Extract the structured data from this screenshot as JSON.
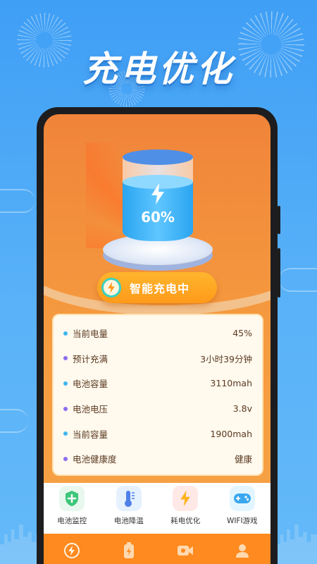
{
  "hero": {
    "title": "充电优化"
  },
  "battery": {
    "percent": "60%",
    "fill_fraction": 0.6
  },
  "status": {
    "label": "智能充电中"
  },
  "info": {
    "rows": [
      {
        "label": "当前电量",
        "value": "45%",
        "dot_color": "#3fb6f0"
      },
      {
        "label": "预计充满",
        "value": "3小时39分钟",
        "dot_color": "#8a6cf0"
      },
      {
        "label": "电池容量",
        "value": "3110mah",
        "dot_color": "#3fb6f0"
      },
      {
        "label": "电池电压",
        "value": "3.8v",
        "dot_color": "#8a6cf0"
      },
      {
        "label": "当前容量",
        "value": "1900mah",
        "dot_color": "#3fb6f0"
      },
      {
        "label": "电池健康度",
        "value": "健康",
        "dot_color": "#8a6cf0"
      }
    ]
  },
  "features": [
    {
      "label": "电池监控",
      "icon": "shield-plus-icon",
      "color": "#e8f8ef"
    },
    {
      "label": "电池降温",
      "icon": "thermometer-icon",
      "color": "#e6f1ff"
    },
    {
      "label": "耗电优化",
      "icon": "bolt-icon",
      "color": "#ffe9e6"
    },
    {
      "label": "WIFI游戏",
      "icon": "gamepad-icon",
      "color": "#e3f6ff"
    }
  ],
  "tabs": [
    {
      "icon": "charge-bolt-icon",
      "active": true
    },
    {
      "icon": "battery-icon",
      "active": false
    },
    {
      "icon": "video-icon",
      "active": false
    },
    {
      "icon": "user-icon",
      "active": false
    }
  ],
  "colors": {
    "background": "#4ba8f6",
    "screen_orange": "#f08a3a",
    "pill": "#ffa723",
    "tab_bar": "#ff8a1f"
  }
}
